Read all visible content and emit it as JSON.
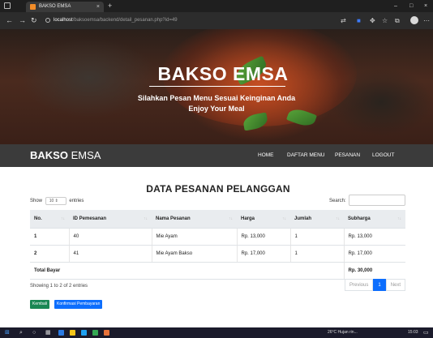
{
  "browser": {
    "tab_title": "BAKSO EMSA",
    "tab_close": "×",
    "new_tab": "+",
    "url_host": "localhost",
    "url_path": "/baksoemsa/backend/detail_pesanan.php?id=49",
    "window_controls": [
      "–",
      "□",
      "×"
    ]
  },
  "hero": {
    "title": "BAKSO EMSA",
    "subtitle_line1": "Silahkan Pesan Menu Sesuai Keinginan Anda",
    "subtitle_line2": "Enjoy Your Meal"
  },
  "navbar": {
    "brand_bold": "BAKSO",
    "brand_rest": " EMSA",
    "links": [
      "HOME",
      "DAFTAR MENU",
      "PESANAN",
      "LOGOUT"
    ]
  },
  "main": {
    "title": "DATA PESANAN PELANGGAN",
    "show_label": "Show",
    "show_value": "10",
    "entries_label": "entries",
    "search_label": "Search:",
    "columns": [
      "No.",
      "ID Pemesanan",
      "Nama Pesanan",
      "Harga",
      "Jumlah",
      "Subharga"
    ],
    "rows": [
      [
        "1",
        "40",
        "Mie Ayam",
        "Rp. 13,000",
        "1",
        "Rp. 13,000"
      ],
      [
        "2",
        "41",
        "Mie Ayam Bakso",
        "Rp. 17,000",
        "1",
        "Rp. 17,000"
      ]
    ],
    "total_label": "Total Bayar",
    "total_value": "Rp. 30,000",
    "info": "Showing 1 to 2 of 2 entries",
    "pager": [
      "Previous",
      "1",
      "Next"
    ],
    "btn_back": "Kembali",
    "btn_confirm": "Konfirmasi Pembayaran"
  },
  "taskbar": {
    "weather": "26°C  Hujan rin...",
    "time": "15:03"
  },
  "colors": {
    "navbar": "#3b3b3b",
    "primary": "#0d6efd",
    "success": "#198754"
  }
}
